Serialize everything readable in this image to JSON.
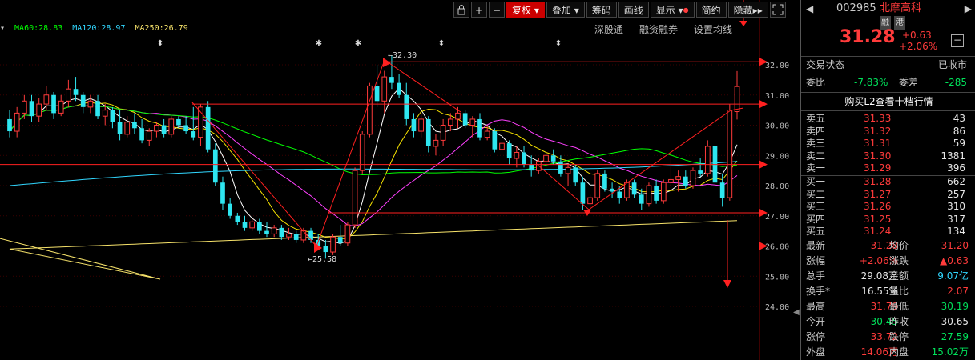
{
  "toolbar": {
    "items": [
      "复权",
      "叠加",
      "筹码",
      "画线",
      "显示",
      "简约",
      "隐藏"
    ],
    "lock_icon": "lock-icon",
    "plus": "+",
    "minus": "−"
  },
  "ma_legend": [
    {
      "label": "MA60:28.83",
      "color": "#00ff00"
    },
    {
      "label": "MA120:28.97",
      "color": "#31d7ff"
    },
    {
      "label": "MA250:26.79",
      "color": "#f6e26a"
    }
  ],
  "sublinks": [
    "深股通",
    "融资融券",
    "设置均线"
  ],
  "chart_data": {
    "type": "candlestick",
    "price_axis": [
      "32.00",
      "31.00",
      "30.00",
      "29.00",
      "28.00",
      "27.00",
      "26.00",
      "25.00",
      "24.00"
    ],
    "ylim": [
      23.7,
      32.2
    ],
    "annotations": {
      "high_label": "32.30",
      "low_label": "25.58"
    },
    "candles": [
      [
        30.2,
        30.5,
        29.6,
        29.8
      ],
      [
        29.8,
        30.6,
        29.6,
        30.4
      ],
      [
        30.4,
        31.0,
        30.2,
        30.8
      ],
      [
        30.8,
        31.0,
        30.1,
        30.3
      ],
      [
        30.3,
        30.9,
        30.1,
        30.7
      ],
      [
        30.7,
        31.3,
        30.5,
        31.0
      ],
      [
        31.0,
        31.1,
        30.2,
        30.4
      ],
      [
        30.4,
        31.0,
        30.3,
        30.8
      ],
      [
        30.8,
        31.5,
        30.6,
        31.2
      ],
      [
        31.2,
        31.6,
        30.8,
        31.0
      ],
      [
        31.0,
        31.1,
        30.4,
        30.6
      ],
      [
        30.6,
        31.0,
        30.4,
        30.8
      ],
      [
        30.8,
        31.0,
        30.2,
        30.3
      ],
      [
        30.3,
        30.7,
        30.0,
        30.5
      ],
      [
        30.5,
        30.6,
        29.9,
        30.1
      ],
      [
        30.1,
        30.5,
        29.5,
        29.7
      ],
      [
        29.7,
        30.3,
        29.6,
        30.1
      ],
      [
        30.1,
        30.4,
        29.7,
        29.9
      ],
      [
        29.9,
        30.2,
        29.4,
        29.5
      ],
      [
        29.5,
        29.9,
        29.3,
        29.8
      ],
      [
        29.8,
        30.1,
        29.6,
        30.0
      ],
      [
        30.0,
        30.2,
        29.6,
        29.7
      ],
      [
        29.7,
        30.3,
        29.6,
        30.2
      ],
      [
        30.2,
        30.3,
        29.9,
        30.0
      ],
      [
        30.0,
        30.3,
        29.7,
        29.8
      ],
      [
        29.8,
        30.6,
        29.5,
        29.6
      ],
      [
        29.6,
        30.7,
        29.3,
        30.6
      ],
      [
        30.6,
        30.8,
        29.1,
        29.2
      ],
      [
        29.2,
        29.4,
        28.0,
        28.1
      ],
      [
        28.1,
        28.3,
        27.2,
        27.4
      ],
      [
        27.4,
        27.6,
        26.9,
        27.0
      ],
      [
        27.0,
        27.1,
        26.7,
        26.8
      ],
      [
        26.8,
        27.0,
        26.5,
        26.6
      ],
      [
        26.6,
        26.9,
        26.5,
        26.8
      ],
      [
        26.8,
        26.9,
        26.4,
        26.5
      ],
      [
        26.5,
        26.8,
        26.3,
        26.4
      ],
      [
        26.4,
        26.7,
        26.3,
        26.6
      ],
      [
        26.6,
        26.7,
        26.2,
        26.3
      ],
      [
        26.3,
        26.6,
        26.2,
        26.4
      ],
      [
        26.4,
        26.5,
        26.1,
        26.2
      ],
      [
        26.2,
        26.6,
        26.1,
        26.5
      ],
      [
        26.5,
        26.6,
        26.1,
        26.2
      ],
      [
        26.2,
        26.4,
        25.9,
        26.0
      ],
      [
        26.0,
        26.2,
        25.58,
        25.8
      ],
      [
        25.8,
        26.4,
        25.7,
        26.3
      ],
      [
        26.3,
        26.7,
        26.0,
        26.1
      ],
      [
        26.1,
        26.8,
        26.0,
        26.7
      ],
      [
        26.7,
        28.6,
        26.6,
        28.5
      ],
      [
        28.5,
        29.8,
        28.4,
        29.7
      ],
      [
        29.7,
        31.4,
        29.6,
        31.3
      ],
      [
        31.3,
        32.0,
        30.6,
        30.8
      ],
      [
        30.8,
        31.8,
        30.4,
        31.6
      ],
      [
        31.6,
        32.3,
        31.2,
        31.4
      ],
      [
        31.4,
        31.7,
        30.9,
        31.0
      ],
      [
        31.0,
        31.4,
        30.0,
        30.2
      ],
      [
        30.2,
        30.4,
        29.6,
        29.8
      ],
      [
        29.8,
        30.4,
        29.6,
        30.2
      ],
      [
        30.2,
        30.3,
        29.1,
        29.3
      ],
      [
        29.3,
        29.7,
        29.0,
        29.5
      ],
      [
        29.5,
        30.2,
        29.3,
        30.0
      ],
      [
        30.0,
        30.4,
        29.8,
        30.2
      ],
      [
        30.2,
        30.6,
        29.9,
        30.4
      ],
      [
        30.4,
        30.5,
        29.9,
        30.0
      ],
      [
        30.0,
        30.3,
        29.6,
        30.2
      ],
      [
        30.2,
        30.4,
        29.5,
        29.6
      ],
      [
        29.6,
        30.0,
        29.5,
        29.8
      ],
      [
        29.8,
        29.9,
        29.1,
        29.2
      ],
      [
        29.2,
        29.5,
        28.8,
        29.4
      ],
      [
        29.4,
        29.5,
        28.7,
        28.9
      ],
      [
        28.9,
        29.3,
        28.6,
        29.1
      ],
      [
        29.1,
        29.3,
        28.6,
        28.7
      ],
      [
        28.7,
        29.0,
        28.3,
        28.5
      ],
      [
        28.5,
        28.9,
        28.4,
        28.8
      ],
      [
        28.8,
        29.1,
        28.6,
        29.0
      ],
      [
        29.0,
        29.2,
        28.7,
        28.8
      ],
      [
        28.8,
        29.0,
        28.3,
        28.4
      ],
      [
        28.4,
        28.7,
        28.0,
        28.6
      ],
      [
        28.6,
        28.7,
        28.0,
        28.1
      ],
      [
        28.1,
        28.3,
        27.2,
        27.4
      ],
      [
        27.4,
        27.7,
        27.2,
        27.6
      ],
      [
        27.6,
        28.5,
        27.5,
        28.4
      ],
      [
        28.4,
        28.5,
        27.8,
        27.9
      ],
      [
        27.9,
        28.1,
        27.6,
        27.8
      ],
      [
        27.8,
        28.0,
        27.4,
        27.6
      ],
      [
        27.6,
        28.2,
        27.5,
        28.1
      ],
      [
        28.1,
        28.2,
        27.6,
        27.7
      ],
      [
        27.7,
        27.9,
        27.2,
        27.4
      ],
      [
        27.4,
        28.1,
        27.3,
        28.0
      ],
      [
        28.0,
        28.2,
        27.4,
        27.5
      ],
      [
        27.5,
        28.2,
        27.4,
        28.1
      ],
      [
        28.1,
        28.9,
        28.0,
        28.2
      ],
      [
        28.2,
        28.5,
        27.8,
        28.3
      ],
      [
        28.3,
        28.5,
        27.9,
        28.0
      ],
      [
        28.0,
        28.6,
        27.9,
        28.5
      ],
      [
        28.5,
        28.9,
        28.3,
        28.4
      ],
      [
        28.4,
        29.5,
        28.3,
        29.3
      ],
      [
        29.3,
        29.5,
        28.0,
        28.1
      ],
      [
        28.1,
        28.4,
        27.3,
        27.6
      ],
      [
        27.6,
        30.7,
        27.5,
        30.5
      ],
      [
        30.45,
        31.79,
        30.19,
        31.28
      ]
    ],
    "support_lines": [
      "32.1",
      "30.7",
      "28.7",
      "27.1",
      "26.0"
    ]
  },
  "quote": {
    "code": "002985",
    "name": "北摩高科",
    "tags": [
      "融",
      "港"
    ],
    "price": "31.28",
    "change": "+0.63",
    "change_pct": "+2.06%"
  },
  "status": {
    "label": "交易状态",
    "value": "已收市"
  },
  "ratio": {
    "wb_label": "委比",
    "wb_value": "-7.83%",
    "wc_label": "委差",
    "wc_value": "-285"
  },
  "l2_link": "购买L2查看十档行情",
  "asks": [
    {
      "label": "卖五",
      "price": "31.33",
      "vol": "43"
    },
    {
      "label": "卖四",
      "price": "31.32",
      "vol": "86"
    },
    {
      "label": "卖三",
      "price": "31.31",
      "vol": "59"
    },
    {
      "label": "卖二",
      "price": "31.30",
      "vol": "1381"
    },
    {
      "label": "卖一",
      "price": "31.29",
      "vol": "396"
    }
  ],
  "bids": [
    {
      "label": "买一",
      "price": "31.28",
      "vol": "662"
    },
    {
      "label": "买二",
      "price": "31.27",
      "vol": "257"
    },
    {
      "label": "买三",
      "price": "31.26",
      "vol": "310"
    },
    {
      "label": "买四",
      "price": "31.25",
      "vol": "317"
    },
    {
      "label": "买五",
      "price": "31.24",
      "vol": "134"
    }
  ],
  "stats": [
    {
      "l1": "最新",
      "v1": "31.28",
      "c1": "red",
      "l2": "均价",
      "v2": "31.20",
      "c2": "red"
    },
    {
      "l1": "涨幅",
      "v1": "+2.06%",
      "c1": "red",
      "l2": "涨跌",
      "v2": "▲0.63",
      "c2": "red"
    },
    {
      "l1": "总手",
      "v1": "29.08万",
      "c1": "white",
      "l2": "金额",
      "v2": "9.07亿",
      "c2": "cyan"
    },
    {
      "l1": "换手*",
      "v1": "16.55%",
      "c1": "white",
      "l2": "量比",
      "v2": "2.07",
      "c2": "red"
    },
    {
      "l1": "最高",
      "v1": "31.79",
      "c1": "red",
      "l2": "最低",
      "v2": "30.19",
      "c2": "green"
    },
    {
      "l1": "今开",
      "v1": "30.45",
      "c1": "green",
      "l2": "昨收",
      "v2": "30.65",
      "c2": "white"
    },
    {
      "l1": "涨停",
      "v1": "33.72",
      "c1": "red",
      "l2": "跌停",
      "v2": "27.59",
      "c2": "green"
    },
    {
      "l1": "外盘",
      "v1": "14.06万",
      "c1": "red",
      "l2": "内盘",
      "v2": "15.02万",
      "c2": "green"
    }
  ]
}
